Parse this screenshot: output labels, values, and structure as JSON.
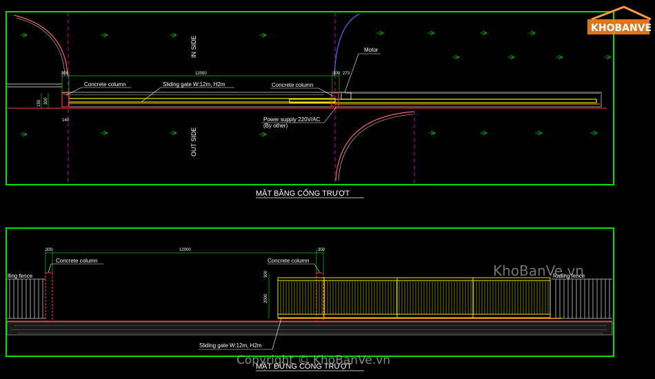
{
  "plan": {
    "inside_label": "IN SIDE",
    "outside_label": "OUT SIDE",
    "dim_total": "12000",
    "dim_left_small": "300",
    "dim_right_small": "300",
    "dim_right_small2": "273",
    "dim_side_a": "150",
    "dim_side_b": "300",
    "dim_below": "140",
    "concrete_column_left": "Concrete column",
    "concrete_column_right": "Concrete column",
    "gate_label": "Sliding gate W:12m, H2m",
    "motor_label": "Motor",
    "power_label": "Power supply 220V/AC",
    "power_note": "(By other)",
    "title": "MẶT BẰNG CỔNG TRƯỢT"
  },
  "elevation": {
    "dim_left_small": "300",
    "dim_total": "12000",
    "dim_right_small": "300",
    "dim_vert_a": "300",
    "dim_vert_b": "2000",
    "concrete_column_left": "Concrete column",
    "concrete_column_right": "Concrete column",
    "fence_left": "lling fence",
    "fence_right": "Railing fence",
    "gate_label": "Sliding gate W:12m, H2m",
    "title": "MẶT ĐỨNG CỔNG TRƯỢT"
  },
  "watermark": {
    "logo_text": "KHOBANVE",
    "site": "KhoBanVe.vn",
    "copyright": "Copyright © KhoBanVe.vn"
  },
  "colors": {
    "frame": "#00e000",
    "gate": "#e8e800",
    "column": "#ff3030",
    "axis": "#c000c0",
    "arc_blue": "#6a6aff",
    "arc_red": "#ff6060",
    "dim": "#00cc00"
  }
}
